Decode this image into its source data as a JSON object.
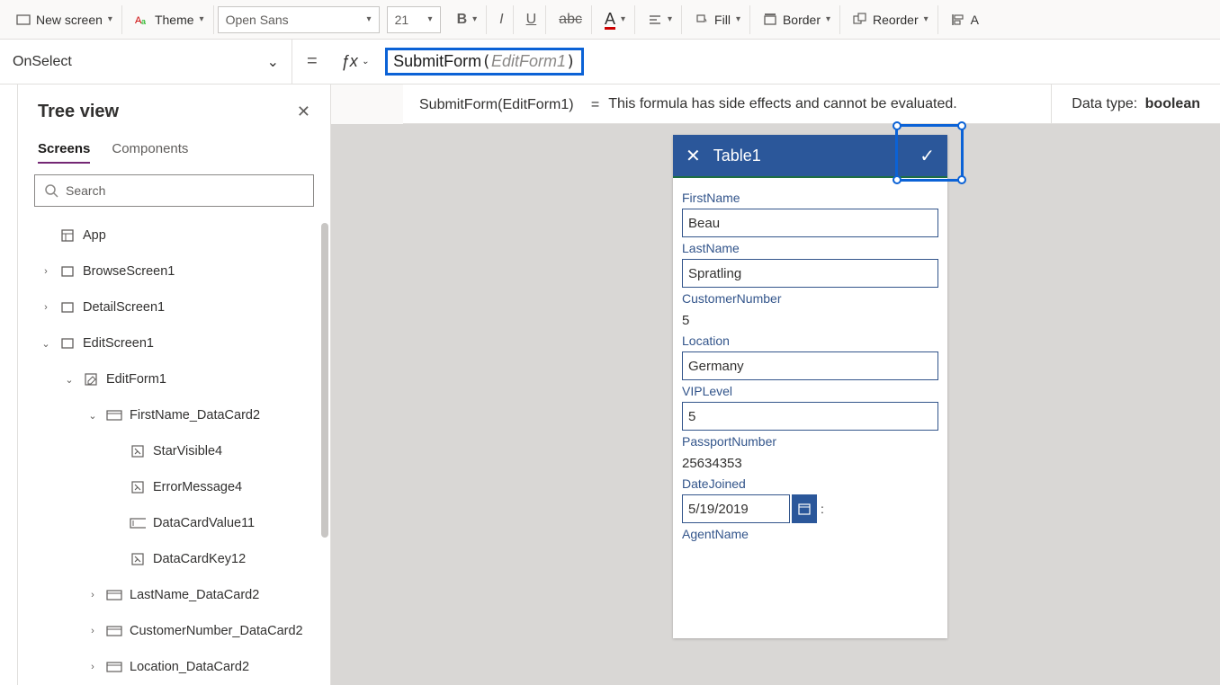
{
  "toolbar": {
    "new_screen": "New screen",
    "theme": "Theme",
    "font_name": "Open Sans",
    "font_size": "21",
    "fill": "Fill",
    "border": "Border",
    "reorder": "Reorder",
    "align": "A"
  },
  "formula": {
    "property": "OnSelect",
    "fn": "SubmitForm",
    "arg": "EditForm1"
  },
  "result": {
    "expr": "SubmitForm(EditForm1)",
    "eq": "=",
    "msg": "This formula has side effects and cannot be evaluated.",
    "dtype_label": "Data type:",
    "dtype": "boolean"
  },
  "tree": {
    "title": "Tree view",
    "tab_screens": "Screens",
    "tab_components": "Components",
    "search_placeholder": "Search",
    "items": [
      {
        "indent": 0,
        "chev": "",
        "iconType": "app",
        "label": "App"
      },
      {
        "indent": 0,
        "chev": "›",
        "iconType": "screen",
        "label": "BrowseScreen1"
      },
      {
        "indent": 0,
        "chev": "›",
        "iconType": "screen",
        "label": "DetailScreen1"
      },
      {
        "indent": 0,
        "chev": "⌄",
        "iconType": "screen",
        "label": "EditScreen1"
      },
      {
        "indent": 1,
        "chev": "⌄",
        "iconType": "form",
        "label": "EditForm1"
      },
      {
        "indent": 2,
        "chev": "⌄",
        "iconType": "card",
        "label": "FirstName_DataCard2"
      },
      {
        "indent": 3,
        "chev": "",
        "iconType": "ctrl",
        "label": "StarVisible4"
      },
      {
        "indent": 3,
        "chev": "",
        "iconType": "ctrl",
        "label": "ErrorMessage4"
      },
      {
        "indent": 3,
        "chev": "",
        "iconType": "input",
        "label": "DataCardValue11"
      },
      {
        "indent": 3,
        "chev": "",
        "iconType": "ctrl",
        "label": "DataCardKey12"
      },
      {
        "indent": 2,
        "chev": "›",
        "iconType": "card",
        "label": "LastName_DataCard2"
      },
      {
        "indent": 2,
        "chev": "›",
        "iconType": "card",
        "label": "CustomerNumber_DataCard2"
      },
      {
        "indent": 2,
        "chev": "›",
        "iconType": "card",
        "label": "Location_DataCard2"
      }
    ]
  },
  "form": {
    "title": "Table1",
    "fields": [
      {
        "label": "FirstName",
        "value": "Beau",
        "type": "input"
      },
      {
        "label": "LastName",
        "value": "Spratling",
        "type": "input"
      },
      {
        "label": "CustomerNumber",
        "value": "5",
        "type": "static"
      },
      {
        "label": "Location",
        "value": "Germany",
        "type": "input"
      },
      {
        "label": "VIPLevel",
        "value": "5",
        "type": "input"
      },
      {
        "label": "PassportNumber",
        "value": "25634353",
        "type": "static"
      },
      {
        "label": "DateJoined",
        "value": "5/19/2019",
        "type": "date"
      },
      {
        "label": "AgentName",
        "value": "",
        "type": "labelonly"
      }
    ]
  }
}
